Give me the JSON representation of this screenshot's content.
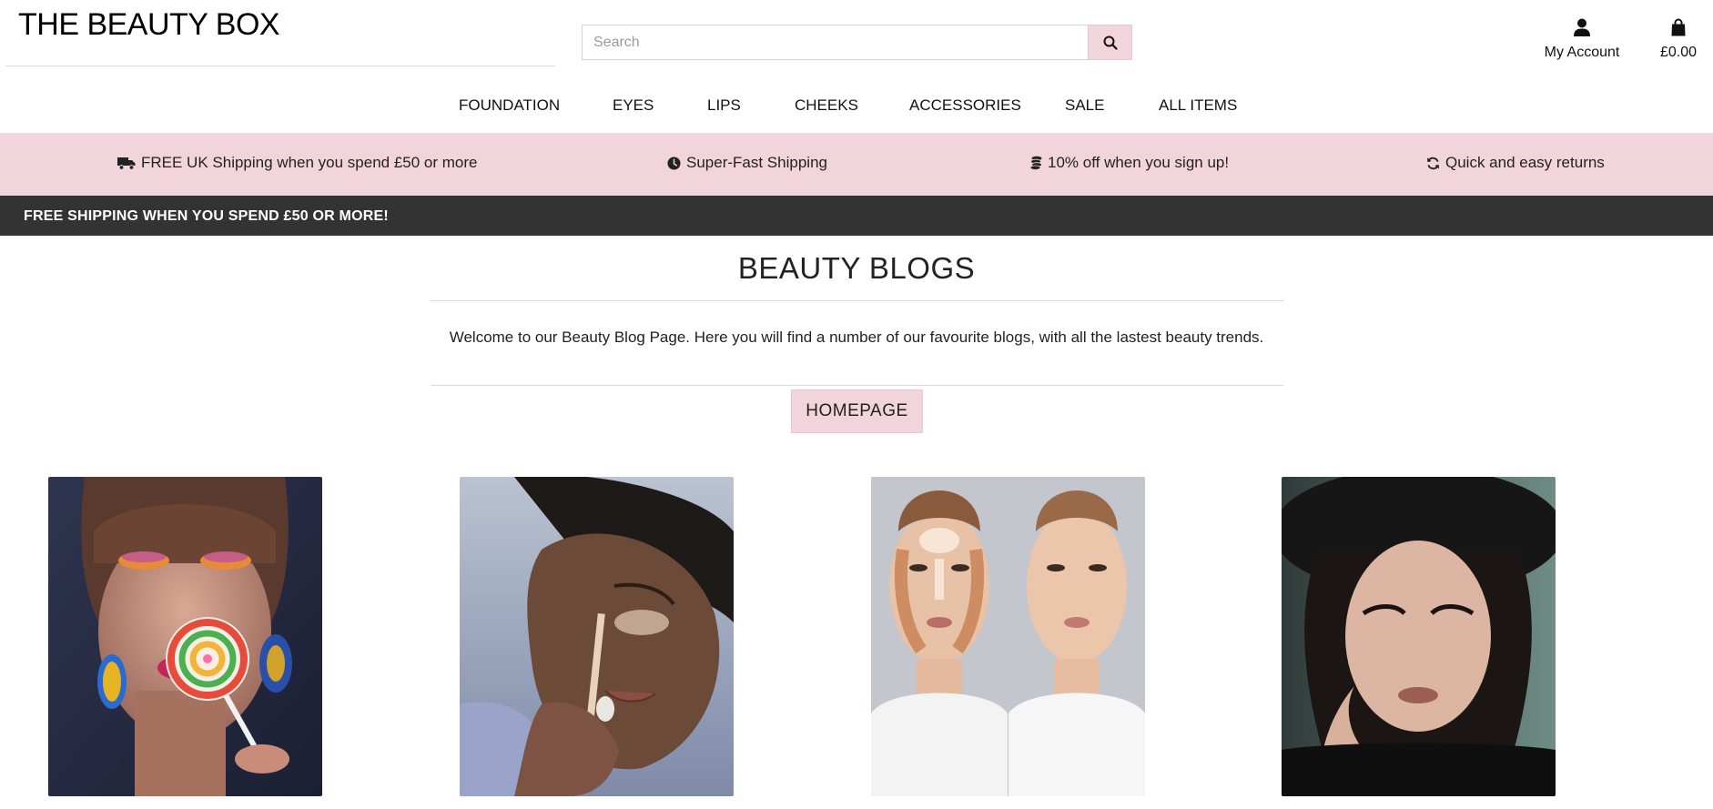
{
  "header": {
    "brand": "THE BEAUTY BOX",
    "search_placeholder": "Search",
    "account_label": "My Account",
    "bag_total": "£0.00"
  },
  "nav": {
    "items": [
      "FOUNDATION",
      "EYES",
      "LIPS",
      "CHEEKS",
      "ACCESSORIES",
      "SALE",
      "ALL ITEMS"
    ]
  },
  "usp": {
    "items": [
      {
        "icon": "truck-icon",
        "text": "FREE UK Shipping when you spend £50 or more"
      },
      {
        "icon": "clock-icon",
        "text": "Super-Fast Shipping"
      },
      {
        "icon": "coins-icon",
        "text": "10% off when you sign up!"
      },
      {
        "icon": "refresh-icon",
        "text": "Quick and easy returns"
      }
    ]
  },
  "banner": {
    "text": "FREE SHIPPING WHEN YOU SPEND £50 OR MORE!"
  },
  "main": {
    "title": "BEAUTY BLOGS",
    "intro": "Welcome to our Beauty Blog Page. Here you will find a number of our favourite blogs, with all the lastest beauty trends.",
    "home_button": "HOMEPAGE"
  },
  "blogs": {
    "items": [
      {
        "image": "woman with colourful eyeshadow licking a lollipop"
      },
      {
        "image": "woman applying concealer with a wand"
      },
      {
        "image": "contouring face chart comparison"
      },
      {
        "image": "woman in black beret with winged eyeliner"
      }
    ]
  },
  "colors": {
    "accent_pink": "#f2d4dd",
    "banner_dark": "#333333"
  }
}
